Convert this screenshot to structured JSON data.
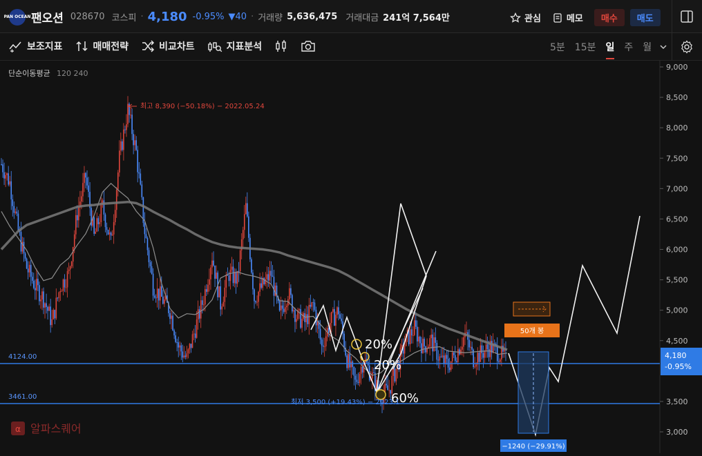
{
  "header": {
    "logo_text": "PAN OCEAN",
    "stock_name": "팬오션",
    "stock_code": "028670",
    "market": "코스피",
    "separator": "·",
    "price": "4,180",
    "change_pct": "-0.95%",
    "change_abs": "▼40",
    "volume_label": "거래량",
    "volume_value": "5,636,475",
    "amount_label": "거래대금",
    "amount_value": "241억 7,564만",
    "watch_label": "관심",
    "memo_label": "메모",
    "buy_label": "매수",
    "sell_label": "매도"
  },
  "toolbar": {
    "tools": [
      "보조지표",
      "매매전략",
      "비교차트",
      "지표분석"
    ],
    "periods": [
      "5분",
      "15분",
      "일",
      "주",
      "월"
    ],
    "active_period": "일"
  },
  "indicator": {
    "name": "단순이동평균",
    "params": "120 240"
  },
  "annotations": {
    "high": "최고 8,390 (−50.18%) − 2022.05.24",
    "low": "최저 3,500 (+19.43%) − 2023.1",
    "line1_label": "4124.00",
    "line2_label": "3461.00",
    "pct_20a": "20%",
    "pct_20b": "20%",
    "pct_60": "60%",
    "box_label": "50개 봉",
    "measure_label": "−1240 (−29.91%)",
    "watermark": "알파스퀘어"
  },
  "price_tag": {
    "price": "4,180",
    "change": "-0.95%"
  },
  "colors": {
    "up": "#e0463c",
    "down": "#4b8cff",
    "accent_orange": "#e8731a",
    "hline": "#2f7be5"
  },
  "chart_data": {
    "type": "line",
    "y_ticks": [
      "9,000",
      "8,500",
      "8,000",
      "7,500",
      "7,000",
      "6,500",
      "6,000",
      "5,500",
      "5,000",
      "4,500",
      "3,500",
      "3,000"
    ],
    "ylim": [
      2900,
      9000
    ],
    "x_index": [
      0,
      6,
      12,
      18,
      24,
      30,
      36,
      42,
      48,
      54,
      60,
      66,
      72,
      78,
      84,
      90,
      96,
      102,
      108,
      114,
      120,
      126,
      132,
      138,
      144,
      150,
      156,
      162,
      168,
      174,
      180,
      186,
      192,
      198,
      204,
      210,
      216,
      222,
      228,
      234,
      240,
      246,
      252,
      258,
      264,
      270,
      276,
      282,
      288,
      294,
      300,
      306,
      312,
      318,
      324,
      330,
      336,
      342,
      348,
      354,
      360
    ],
    "series": [
      {
        "values": [
          7400,
          7100,
          6300,
          5700,
          5400,
          5200,
          4800,
          5400,
          5600,
          6600,
          7200,
          6200,
          6700,
          6100,
          7500,
          8300,
          7600,
          6300,
          5400,
          5200,
          5000,
          4400,
          4200,
          4700,
          5200,
          5900,
          5100,
          5600,
          5500,
          6700,
          5200,
          5400,
          5600,
          4900,
          5300,
          4900,
          4800,
          5100,
          4400,
          4800,
          5000,
          4200,
          3800,
          4200,
          3900,
          3600,
          3700,
          4100,
          4500,
          4700,
          4400,
          4500,
          4200,
          4100,
          4300,
          4600,
          4200,
          4300,
          4400,
          4300,
          4180
        ]
      },
      {
        "values": [
          6000,
          6150,
          6300,
          6400,
          6450,
          6500,
          6550,
          6600,
          6650,
          6700,
          6720,
          6730,
          6750,
          6760,
          6770,
          6780,
          6760,
          6700,
          6620,
          6550,
          6480,
          6400,
          6330,
          6250,
          6180,
          6120,
          6080,
          6050,
          6030,
          6020,
          6010,
          6000,
          5980,
          5950,
          5900,
          5860,
          5820,
          5780,
          5740,
          5700,
          5650,
          5580,
          5500,
          5420,
          5340,
          5260,
          5180,
          5100,
          5020,
          4950,
          4880,
          4820,
          4760,
          4700,
          4650,
          4600,
          4550,
          4500,
          4450,
          4400,
          4350
        ]
      }
    ]
  }
}
